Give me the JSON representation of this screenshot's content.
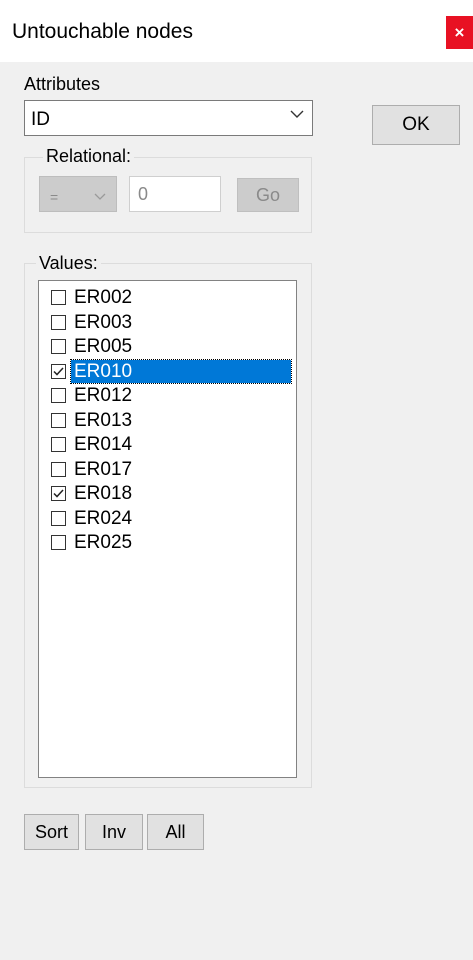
{
  "window": {
    "title": "Untouchable nodes",
    "close_symbol": "×"
  },
  "attributes": {
    "label": "Attributes",
    "selected": "ID"
  },
  "ok_button": {
    "label": "OK"
  },
  "relational": {
    "label": "Relational:",
    "operator": "=",
    "value": "0",
    "go_label": "Go"
  },
  "values": {
    "label": "Values:",
    "items": [
      {
        "label": "ER002",
        "checked": false,
        "selected": false
      },
      {
        "label": "ER003",
        "checked": false,
        "selected": false
      },
      {
        "label": "ER005",
        "checked": false,
        "selected": false
      },
      {
        "label": "ER010",
        "checked": true,
        "selected": true
      },
      {
        "label": "ER012",
        "checked": false,
        "selected": false
      },
      {
        "label": "ER013",
        "checked": false,
        "selected": false
      },
      {
        "label": "ER014",
        "checked": false,
        "selected": false
      },
      {
        "label": "ER017",
        "checked": false,
        "selected": false
      },
      {
        "label": "ER018",
        "checked": true,
        "selected": false
      },
      {
        "label": "ER024",
        "checked": false,
        "selected": false
      },
      {
        "label": "ER025",
        "checked": false,
        "selected": false
      }
    ]
  },
  "bottom_buttons": {
    "sort": "Sort",
    "inv": "Inv",
    "all": "All"
  },
  "colors": {
    "selection": "#0078d7",
    "close": "#e81123",
    "background": "#f0f0f0"
  }
}
